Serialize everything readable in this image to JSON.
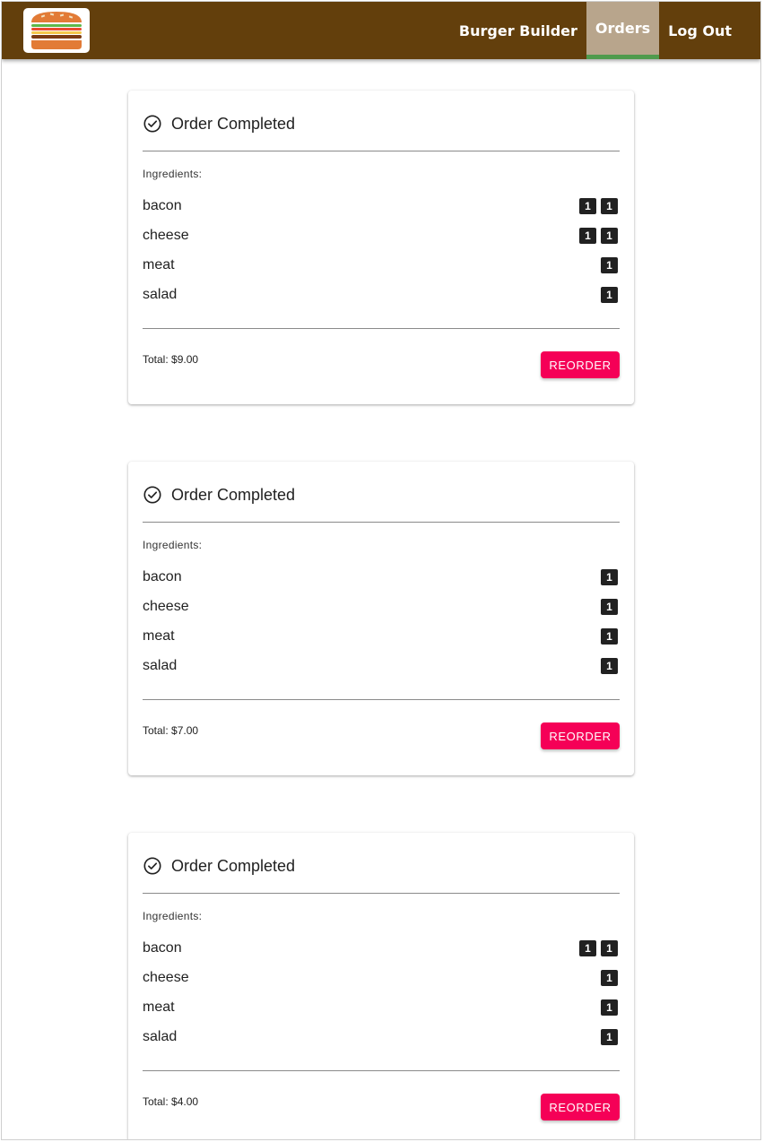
{
  "nav": {
    "items": [
      {
        "label": "Burger Builder",
        "active": false
      },
      {
        "label": "Orders",
        "active": true
      },
      {
        "label": "Log Out",
        "active": false
      }
    ]
  },
  "orders": [
    {
      "title": "Order Completed",
      "ingredients_label": "Ingredients:",
      "ingredients": [
        {
          "name": "bacon",
          "badges": [
            "1",
            "1"
          ]
        },
        {
          "name": "cheese",
          "badges": [
            "1",
            "1"
          ]
        },
        {
          "name": "meat",
          "badges": [
            "1"
          ]
        },
        {
          "name": "salad",
          "badges": [
            "1"
          ]
        }
      ],
      "total": "Total: $9.00",
      "button_label": "REORDER"
    },
    {
      "title": "Order Completed",
      "ingredients_label": "Ingredients:",
      "ingredients": [
        {
          "name": "bacon",
          "badges": [
            "1"
          ]
        },
        {
          "name": "cheese",
          "badges": [
            "1"
          ]
        },
        {
          "name": "meat",
          "badges": [
            "1"
          ]
        },
        {
          "name": "salad",
          "badges": [
            "1"
          ]
        }
      ],
      "total": "Total: $7.00",
      "button_label": "REORDER"
    },
    {
      "title": "Order Completed",
      "ingredients_label": "Ingredients:",
      "ingredients": [
        {
          "name": "bacon",
          "badges": [
            "1",
            "1"
          ]
        },
        {
          "name": "cheese",
          "badges": [
            "1"
          ]
        },
        {
          "name": "meat",
          "badges": [
            "1"
          ]
        },
        {
          "name": "salad",
          "badges": [
            "1"
          ]
        }
      ],
      "total": "Total: $4.00",
      "button_label": "REORDER"
    }
  ],
  "colors": {
    "toolbar": "#633f0c",
    "active_nav": "#b8a58c",
    "active_indicator": "#4f9b4d",
    "reorder_button": "#f50057",
    "badge": "#212121"
  }
}
